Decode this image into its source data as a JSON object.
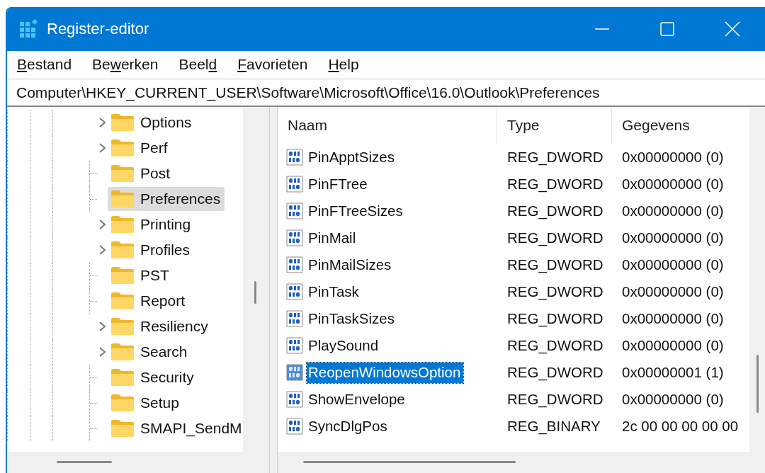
{
  "window": {
    "title": "Register-editor"
  },
  "menu": [
    {
      "key": "B",
      "after": "estand"
    },
    {
      "before": "Be",
      "key": "w",
      "after": "erken"
    },
    {
      "before": "Beel",
      "key": "d"
    },
    {
      "key": "F",
      "after": "avorieten"
    },
    {
      "key": "H",
      "after": "elp"
    }
  ],
  "address": "Computer\\HKEY_CURRENT_USER\\Software\\Microsoft\\Office\\16.0\\Outlook\\Preferences",
  "tree": {
    "items": [
      {
        "label": "Options",
        "expandable": true,
        "selected": false
      },
      {
        "label": "Perf",
        "expandable": true,
        "selected": false
      },
      {
        "label": "Post",
        "expandable": false,
        "selected": false
      },
      {
        "label": "Preferences",
        "expandable": false,
        "selected": true
      },
      {
        "label": "Printing",
        "expandable": true,
        "selected": false
      },
      {
        "label": "Profiles",
        "expandable": true,
        "selected": false
      },
      {
        "label": "PST",
        "expandable": false,
        "selected": false
      },
      {
        "label": "Report",
        "expandable": false,
        "selected": false
      },
      {
        "label": "Resiliency",
        "expandable": true,
        "selected": false
      },
      {
        "label": "Search",
        "expandable": true,
        "selected": false
      },
      {
        "label": "Security",
        "expandable": false,
        "selected": false
      },
      {
        "label": "Setup",
        "expandable": false,
        "selected": false
      },
      {
        "label": "SMAPI_SendM",
        "expandable": false,
        "selected": false
      }
    ]
  },
  "table": {
    "columns": [
      "Naam",
      "Type",
      "Gegevens"
    ],
    "rows": [
      {
        "name": "PinApptSizes",
        "type": "REG_DWORD",
        "data": "0x00000000 (0)",
        "selected": false
      },
      {
        "name": "PinFTree",
        "type": "REG_DWORD",
        "data": "0x00000000 (0)",
        "selected": false
      },
      {
        "name": "PinFTreeSizes",
        "type": "REG_DWORD",
        "data": "0x00000000 (0)",
        "selected": false
      },
      {
        "name": "PinMail",
        "type": "REG_DWORD",
        "data": "0x00000000 (0)",
        "selected": false
      },
      {
        "name": "PinMailSizes",
        "type": "REG_DWORD",
        "data": "0x00000000 (0)",
        "selected": false
      },
      {
        "name": "PinTask",
        "type": "REG_DWORD",
        "data": "0x00000000 (0)",
        "selected": false
      },
      {
        "name": "PinTaskSizes",
        "type": "REG_DWORD",
        "data": "0x00000000 (0)",
        "selected": false
      },
      {
        "name": "PlaySound",
        "type": "REG_DWORD",
        "data": "0x00000000 (0)",
        "selected": false
      },
      {
        "name": "ReopenWindowsOption",
        "type": "REG_DWORD",
        "data": "0x00000001 (1)",
        "selected": true
      },
      {
        "name": "ShowEnvelope",
        "type": "REG_DWORD",
        "data": "0x00000000 (0)",
        "selected": false
      },
      {
        "name": "SyncDlgPos",
        "type": "REG_BINARY",
        "data": "2c 00 00 00 00 00",
        "selected": false
      }
    ]
  }
}
